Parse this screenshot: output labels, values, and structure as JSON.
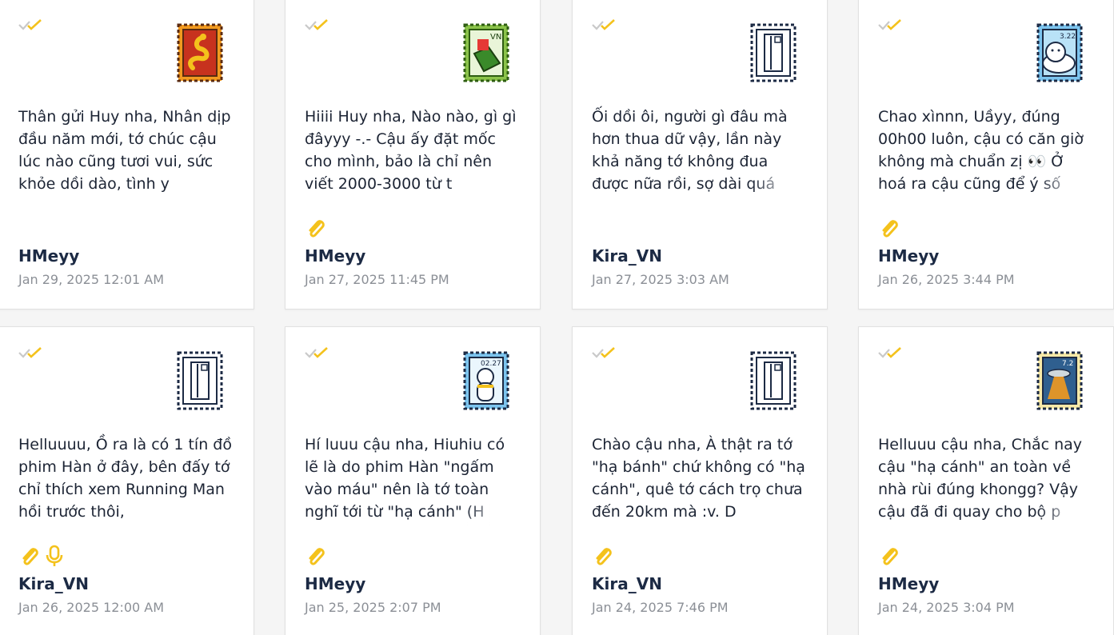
{
  "colors": {
    "accent": "#f4c21c",
    "tick_gray": "#c9c9c9",
    "text": "#1c2434",
    "author": "#1c2a44",
    "date": "#8b8f96"
  },
  "cards": [
    {
      "message": "Thân gửi Huy nha, Nhân dịp đầu năm mới, tớ chúc cậu lúc nào cũng tươi vui, sức khỏe dồi dào, tình y",
      "author": "HMeyy",
      "date": "Jan 29, 2025 12:01 AM",
      "stamp_icon": "snake-stamp-icon",
      "attachments": []
    },
    {
      "message": "Hiiii Huy nha, Nào nào, gì gì đâyyy -.- Cậu ấy đặt mốc cho mình, bảo là chỉ nên viết 2000-3000 từ t",
      "author": "HMeyy",
      "date": "Jan 27, 2025 11:45 PM",
      "stamp_icon": "vn-gift-stamp-icon",
      "stamp_text": "VN",
      "attachments": [
        "paperclip-icon"
      ]
    },
    {
      "message": "Ối dồi ôi, người gì đâu mà hơn thua dữ vậy, lần này khả năng tớ không đua được nữa rồi, sợ dài quá",
      "author": "Kira_VN",
      "date": "Jan 27, 2025 3:03 AM",
      "stamp_icon": "door-stamp-icon",
      "attachments": []
    },
    {
      "message": "Chao xìnnn, Uầyy, đúng 00h00 luôn, cậu có căn giờ không mà chuẩn zị 👀 Ở hoá ra cậu cũng để ý số",
      "author": "HMeyy",
      "date": "Jan 26, 2025 3:44 PM",
      "stamp_icon": "seal-stamp-icon",
      "stamp_text": "3.22",
      "attachments": [
        "paperclip-icon"
      ]
    },
    {
      "message": "Helluuuu, Ồ ra là có 1 tín đồ phim Hàn ở đây, bên đấy tớ chỉ thích xem Running Man hồi trước thôi,",
      "author": "Kira_VN",
      "date": "Jan 26, 2025 12:00 AM",
      "stamp_icon": "door-stamp-icon",
      "attachments": [
        "paperclip-icon",
        "microphone-icon"
      ]
    },
    {
      "message": "Hí luuu cậu nha, Hiuhiu có lẽ là do phim Hàn \"ngấm vào máu\" nên là tớ toàn nghĩ tới từ \"hạ cánh\" (H",
      "author": "HMeyy",
      "date": "Jan 25, 2025 2:07 PM",
      "stamp_icon": "polar-bear-stamp-icon",
      "stamp_text": "02.27",
      "attachments": [
        "paperclip-icon"
      ]
    },
    {
      "message": "Chào cậu nha, À thật ra tớ \"hạ bánh\" chứ không có \"hạ cánh\", quê tớ cách trọ chưa đến 20km mà :v. D",
      "author": "Kira_VN",
      "date": "Jan 24, 2025 7:46 PM",
      "stamp_icon": "door-stamp-icon",
      "attachments": [
        "paperclip-icon"
      ]
    },
    {
      "message": "Helluuu cậu nha, Chắc nay cậu \"hạ cánh\" an toàn về nhà rùi đúng khongg? Vậy cậu đã đi quay cho bộ p",
      "author": "HMeyy",
      "date": "Jan 24, 2025 3:04 PM",
      "stamp_icon": "ufo-stamp-icon",
      "stamp_text": "7.2",
      "attachments": [
        "paperclip-icon"
      ]
    }
  ]
}
